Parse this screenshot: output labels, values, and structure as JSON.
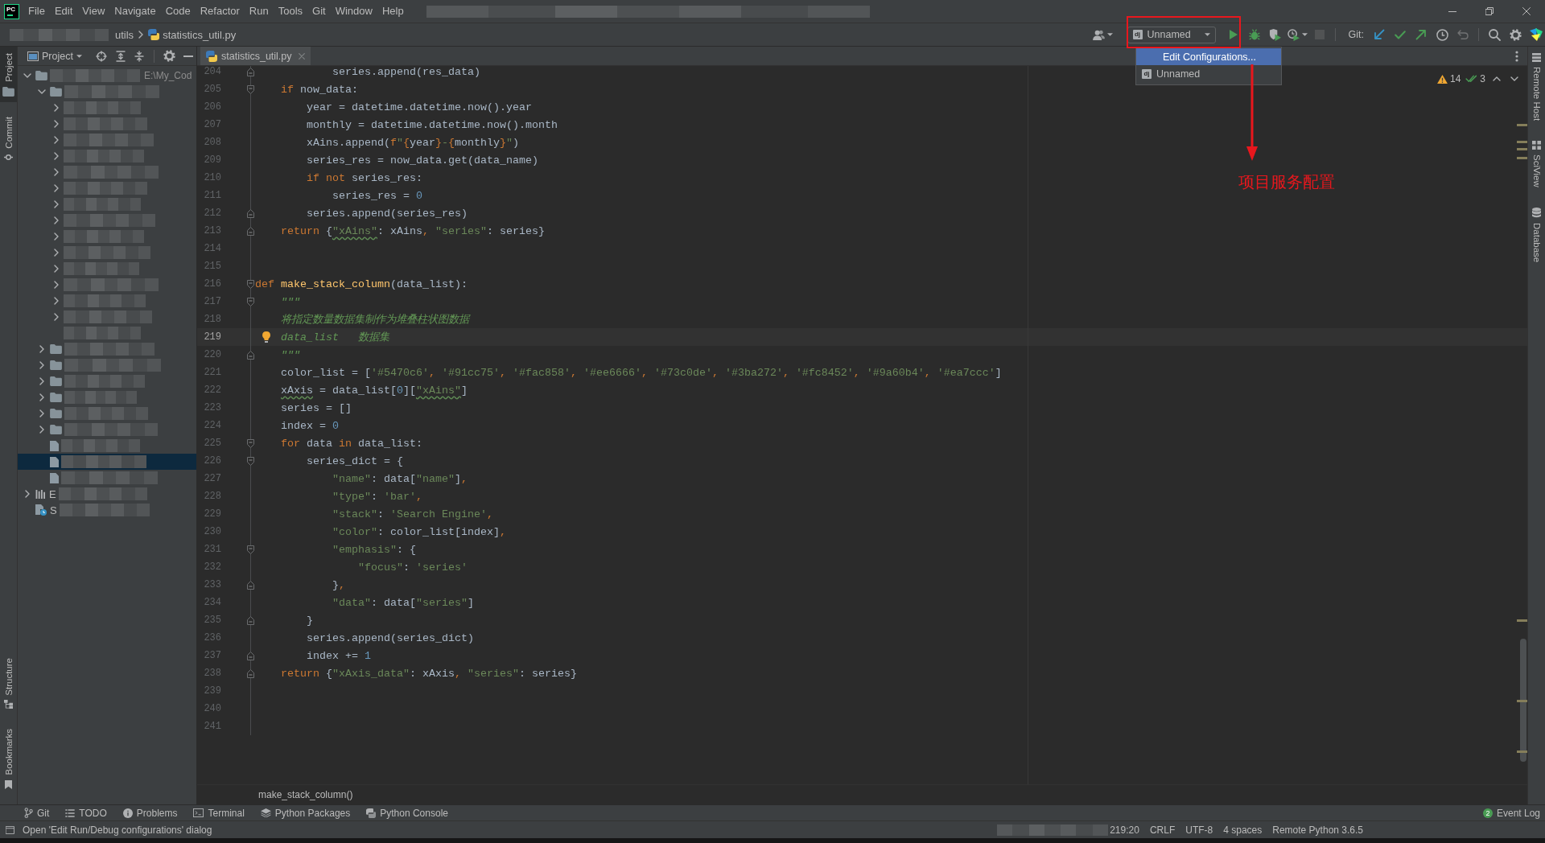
{
  "menu_bar": {
    "logo": "PC",
    "items": [
      "File",
      "Edit",
      "View",
      "Navigate",
      "Code",
      "Refactor",
      "Run",
      "Tools",
      "Git",
      "Window",
      "Help"
    ]
  },
  "navigation_bar": {
    "crumbs": [
      {
        "kind": "folder",
        "label": "utils"
      },
      {
        "kind": "python_file",
        "label": "statistics_util.py"
      }
    ]
  },
  "toolbar": {
    "left_buttons": [
      {
        "kind": "users",
        "disabled": false
      }
    ],
    "run_config": {
      "tag": "dj",
      "label": "Unnamed"
    },
    "run_buttons": [
      {
        "kind": "run",
        "disabled": false
      },
      {
        "kind": "debug",
        "disabled": false
      },
      {
        "kind": "coverage",
        "disabled": false
      },
      {
        "kind": "profile",
        "disabled": false
      },
      {
        "kind": "stop",
        "disabled": true
      }
    ],
    "git_label": "Git:",
    "git_buttons": [
      {
        "kind": "update",
        "disabled": false
      },
      {
        "kind": "commit",
        "disabled": false
      },
      {
        "kind": "push",
        "disabled": false
      },
      {
        "kind": "history",
        "disabled": false
      },
      {
        "kind": "rollback",
        "disabled": true
      }
    ],
    "tool_buttons": [
      {
        "kind": "search",
        "disabled": false
      },
      {
        "kind": "settings",
        "disabled": false
      },
      {
        "kind": "logo",
        "disabled": false
      }
    ]
  },
  "run_config_menu": {
    "items": [
      {
        "label": "Edit Configurations...",
        "selected": true
      },
      {
        "tag": "dj",
        "label": "Unnamed",
        "selected": false
      }
    ]
  },
  "annotation": {
    "label": "项目服务配置"
  },
  "left_tool_strip": {
    "top": [
      {
        "kind": "project",
        "label": "Project",
        "selected": true
      },
      {
        "kind": "commit",
        "label": "Commit",
        "selected": false
      }
    ],
    "bottom": [
      {
        "kind": "structure",
        "label": "Structure",
        "selected": false
      },
      {
        "kind": "bookmarks",
        "label": "Bookmarks",
        "selected": false
      }
    ]
  },
  "project_panel": {
    "title": "Project",
    "tree": [
      {
        "kind": "folder",
        "expanded": true,
        "selected": false,
        "path": "E:\\My_Cod",
        "children": [
          {
            "kind": "folder",
            "expanded": true,
            "selected": false,
            "children": [
              {
                "expanded": false,
                "selected": false
              },
              {
                "expanded": false,
                "selected": false
              },
              {
                "expanded": false,
                "selected": false
              },
              {
                "expanded": false,
                "selected": false
              },
              {
                "expanded": false,
                "selected": false
              },
              {
                "expanded": false,
                "selected": false
              },
              {
                "expanded": false,
                "selected": false
              },
              {
                "expanded": false,
                "selected": false
              },
              {
                "expanded": false,
                "selected": false
              },
              {
                "expanded": false,
                "selected": false
              },
              {
                "expanded": false,
                "selected": false
              },
              {
                "expanded": false,
                "selected": false
              },
              {
                "expanded": false,
                "selected": false
              },
              {
                "expanded": false,
                "selected": false
              },
              {
                "selected": false
              }
            ]
          },
          {
            "kind": "folder",
            "expanded": false,
            "selected": false
          },
          {
            "kind": "folder",
            "expanded": false,
            "selected": false
          },
          {
            "kind": "folder",
            "expanded": false,
            "selected": false
          },
          {
            "kind": "folder",
            "expanded": false,
            "selected": false
          },
          {
            "kind": "folder",
            "expanded": false,
            "selected": false
          },
          {
            "kind": "folder",
            "expanded": false,
            "selected": false
          },
          {
            "kind": "file",
            "selected": false
          },
          {
            "kind": "file",
            "selected": true
          },
          {
            "kind": "file",
            "selected": false
          }
        ]
      },
      {
        "kind": "libraries",
        "expanded": false,
        "selected": false,
        "label": "E"
      },
      {
        "kind": "scratches",
        "selected": false,
        "label": "S"
      }
    ]
  },
  "editor": {
    "tabs": [
      {
        "label": "statistics_util.py",
        "selected": true
      }
    ],
    "inspections": {
      "warnings": "14",
      "weak_warnings": "3"
    },
    "lines": [
      {
        "number": "204",
        "current": false,
        "fold": {
          "kind": "end"
        },
        "tokens": [
          {
            "kind": "plain",
            "text": "            series.append(res_data)"
          }
        ]
      },
      {
        "number": "205",
        "current": false,
        "fold": {
          "kind": "start"
        },
        "tokens": [
          {
            "kind": "kw",
            "text": "    if"
          },
          {
            "kind": "plain",
            "text": " now_data:"
          }
        ]
      },
      {
        "number": "206",
        "current": false,
        "tokens": [
          {
            "kind": "plain",
            "text": "        year = datetime.datetime.now().year"
          }
        ]
      },
      {
        "number": "207",
        "current": false,
        "tokens": [
          {
            "kind": "plain",
            "text": "        monthly = datetime.datetime.now().month"
          }
        ]
      },
      {
        "number": "208",
        "current": false,
        "tokens": [
          {
            "kind": "plain",
            "text": "        xAins.append("
          },
          {
            "kind": "kw",
            "text": "f"
          },
          {
            "kind": "str",
            "text": "\""
          },
          {
            "kind": "punct",
            "text": "{"
          },
          {
            "kind": "plain",
            "text": "year"
          },
          {
            "kind": "punct",
            "text": "}"
          },
          {
            "kind": "str",
            "text": "-"
          },
          {
            "kind": "punct",
            "text": "{"
          },
          {
            "kind": "plain",
            "text": "monthly"
          },
          {
            "kind": "punct",
            "text": "}"
          },
          {
            "kind": "str",
            "text": "\""
          },
          {
            "kind": "plain",
            "text": ")"
          }
        ]
      },
      {
        "number": "209",
        "current": false,
        "tokens": [
          {
            "kind": "plain",
            "text": "        series_res = now_data.get(data_name)"
          }
        ]
      },
      {
        "number": "210",
        "current": false,
        "tokens": [
          {
            "kind": "kw",
            "text": "        if not"
          },
          {
            "kind": "plain",
            "text": " series_res:"
          }
        ]
      },
      {
        "number": "211",
        "current": false,
        "tokens": [
          {
            "kind": "plain",
            "text": "            series_res = "
          },
          {
            "kind": "num",
            "text": "0"
          }
        ]
      },
      {
        "number": "212",
        "current": false,
        "fold": {
          "kind": "end"
        },
        "tokens": [
          {
            "kind": "plain",
            "text": "        series.append(series_res)"
          }
        ]
      },
      {
        "number": "213",
        "current": false,
        "fold": {
          "kind": "end"
        },
        "tokens": [
          {
            "kind": "kw",
            "text": "    return"
          },
          {
            "kind": "plain",
            "text": " {"
          },
          {
            "kind": "typo_str",
            "text": "\"xAins\""
          },
          {
            "kind": "plain",
            "text": ": xAins"
          },
          {
            "kind": "punct",
            "text": ", "
          },
          {
            "kind": "str",
            "text": "\"series\""
          },
          {
            "kind": "plain",
            "text": ": series}"
          }
        ]
      },
      {
        "number": "214",
        "current": false
      },
      {
        "number": "215",
        "current": false
      },
      {
        "number": "216",
        "current": false,
        "fold": {
          "kind": "start"
        },
        "tokens": [
          {
            "kind": "kw",
            "text": "def "
          },
          {
            "kind": "fn",
            "text": "make_stack_column"
          },
          {
            "kind": "plain",
            "text": "(data_list):"
          }
        ]
      },
      {
        "number": "217",
        "current": false,
        "fold": {
          "kind": "start"
        },
        "tokens": [
          {
            "kind": "doc",
            "text": "    \"\"\""
          }
        ]
      },
      {
        "number": "218",
        "current": false,
        "tokens": [
          {
            "kind": "doc",
            "text": "    将指定数量数据集制作为堆叠柱状图数据"
          }
        ]
      },
      {
        "number": "219",
        "current": true,
        "tokens": [
          {
            "kind": "doc",
            "text": "    data_list   数据集"
          }
        ]
      },
      {
        "number": "220",
        "current": false,
        "fold": {
          "kind": "end"
        },
        "tokens": [
          {
            "kind": "doc",
            "text": "    \"\"\""
          }
        ]
      },
      {
        "number": "221",
        "current": false,
        "tokens": [
          {
            "kind": "plain",
            "text": "    color_list = ["
          },
          {
            "kind": "str",
            "text": "'#5470c6'"
          },
          {
            "kind": "punct",
            "text": ", "
          },
          {
            "kind": "str",
            "text": "'#91cc75'"
          },
          {
            "kind": "punct",
            "text": ", "
          },
          {
            "kind": "str",
            "text": "'#fac858'"
          },
          {
            "kind": "punct",
            "text": ", "
          },
          {
            "kind": "str",
            "text": "'#ee6666'"
          },
          {
            "kind": "punct",
            "text": ", "
          },
          {
            "kind": "str",
            "text": "'#73c0de'"
          },
          {
            "kind": "punct",
            "text": ", "
          },
          {
            "kind": "str",
            "text": "'#3ba272'"
          },
          {
            "kind": "punct",
            "text": ", "
          },
          {
            "kind": "str",
            "text": "'#fc8452'"
          },
          {
            "kind": "punct",
            "text": ", "
          },
          {
            "kind": "str",
            "text": "'#9a60b4'"
          },
          {
            "kind": "punct",
            "text": ", "
          },
          {
            "kind": "str",
            "text": "'#ea7ccc'"
          },
          {
            "kind": "plain",
            "text": "]"
          }
        ]
      },
      {
        "number": "222",
        "current": false,
        "tokens": [
          {
            "kind": "typo",
            "text": "    xAxis"
          },
          {
            "kind": "plain",
            "text": " = data_list["
          },
          {
            "kind": "num",
            "text": "0"
          },
          {
            "kind": "plain",
            "text": "]["
          },
          {
            "kind": "typo_str",
            "text": "\"xAins\""
          },
          {
            "kind": "plain",
            "text": "]"
          }
        ]
      },
      {
        "number": "223",
        "current": false,
        "tokens": [
          {
            "kind": "plain",
            "text": "    series = []"
          }
        ]
      },
      {
        "number": "224",
        "current": false,
        "tokens": [
          {
            "kind": "plain",
            "text": "    index = "
          },
          {
            "kind": "num",
            "text": "0"
          }
        ]
      },
      {
        "number": "225",
        "current": false,
        "fold": {
          "kind": "start"
        },
        "tokens": [
          {
            "kind": "kw",
            "text": "    for"
          },
          {
            "kind": "plain",
            "text": " data "
          },
          {
            "kind": "kw",
            "text": "in"
          },
          {
            "kind": "plain",
            "text": " data_list:"
          }
        ]
      },
      {
        "number": "226",
        "current": false,
        "fold": {
          "kind": "start"
        },
        "tokens": [
          {
            "kind": "plain",
            "text": "        series_dict = {"
          }
        ]
      },
      {
        "number": "227",
        "current": false,
        "tokens": [
          {
            "kind": "str",
            "text": "            \"name\""
          },
          {
            "kind": "plain",
            "text": ": data["
          },
          {
            "kind": "str",
            "text": "\"name\""
          },
          {
            "kind": "plain",
            "text": "]"
          },
          {
            "kind": "punct",
            "text": ","
          }
        ]
      },
      {
        "number": "228",
        "current": false,
        "tokens": [
          {
            "kind": "str",
            "text": "            \"type\""
          },
          {
            "kind": "plain",
            "text": ": "
          },
          {
            "kind": "str",
            "text": "'bar'"
          },
          {
            "kind": "punct",
            "text": ","
          }
        ]
      },
      {
        "number": "229",
        "current": false,
        "tokens": [
          {
            "kind": "str",
            "text": "            \"stack\""
          },
          {
            "kind": "plain",
            "text": ": "
          },
          {
            "kind": "str",
            "text": "'Search Engine'"
          },
          {
            "kind": "punct",
            "text": ","
          }
        ]
      },
      {
        "number": "230",
        "current": false,
        "tokens": [
          {
            "kind": "str",
            "text": "            \"color\""
          },
          {
            "kind": "plain",
            "text": ": color_list[index]"
          },
          {
            "kind": "punct",
            "text": ","
          }
        ]
      },
      {
        "number": "231",
        "current": false,
        "fold": {
          "kind": "start"
        },
        "tokens": [
          {
            "kind": "str",
            "text": "            \"emphasis\""
          },
          {
            "kind": "plain",
            "text": ": {"
          }
        ]
      },
      {
        "number": "232",
        "current": false,
        "tokens": [
          {
            "kind": "str",
            "text": "                \"focus\""
          },
          {
            "kind": "plain",
            "text": ": "
          },
          {
            "kind": "str",
            "text": "'series'"
          }
        ]
      },
      {
        "number": "233",
        "current": false,
        "fold": {
          "kind": "end"
        },
        "tokens": [
          {
            "kind": "plain",
            "text": "            }"
          },
          {
            "kind": "punct",
            "text": ","
          }
        ]
      },
      {
        "number": "234",
        "current": false,
        "tokens": [
          {
            "kind": "str",
            "text": "            \"data\""
          },
          {
            "kind": "plain",
            "text": ": data["
          },
          {
            "kind": "str",
            "text": "\"series\""
          },
          {
            "kind": "plain",
            "text": "]"
          }
        ]
      },
      {
        "number": "235",
        "current": false,
        "fold": {
          "kind": "end"
        },
        "tokens": [
          {
            "kind": "plain",
            "text": "        }"
          }
        ]
      },
      {
        "number": "236",
        "current": false,
        "tokens": [
          {
            "kind": "plain",
            "text": "        series.append(series_dict)"
          }
        ]
      },
      {
        "number": "237",
        "current": false,
        "fold": {
          "kind": "end"
        },
        "tokens": [
          {
            "kind": "plain",
            "text": "        index += "
          },
          {
            "kind": "num",
            "text": "1"
          }
        ]
      },
      {
        "number": "238",
        "current": false,
        "fold": {
          "kind": "end"
        },
        "tokens": [
          {
            "kind": "kw",
            "text": "    return"
          },
          {
            "kind": "plain",
            "text": " {"
          },
          {
            "kind": "str",
            "text": "\"xAxis_data\""
          },
          {
            "kind": "plain",
            "text": ": xAxis"
          },
          {
            "kind": "punct",
            "text": ", "
          },
          {
            "kind": "str",
            "text": "\"series\""
          },
          {
            "kind": "plain",
            "text": ": series}"
          }
        ]
      },
      {
        "number": "239",
        "current": false
      },
      {
        "number": "240",
        "current": false
      },
      {
        "number": "241",
        "current": false
      }
    ],
    "breadcrumb": "make_stack_column()"
  },
  "right_tool_strip": [
    {
      "kind": "remote_host",
      "label": "Remote Host",
      "selected": false
    },
    {
      "kind": "sciview",
      "label": "SciView",
      "selected": false
    },
    {
      "kind": "database",
      "label": "Database",
      "selected": false
    }
  ],
  "tool_window_bar": {
    "items": [
      {
        "kind": "git",
        "label": "Git"
      },
      {
        "kind": "todo",
        "label": "TODO"
      },
      {
        "kind": "problems",
        "label": "Problems"
      },
      {
        "kind": "terminal",
        "label": "Terminal"
      },
      {
        "kind": "packages",
        "label": "Python Packages"
      },
      {
        "kind": "console",
        "label": "Python Console"
      }
    ],
    "event_log": {
      "label": "Event Log",
      "count": "2"
    }
  },
  "status_bar": {
    "message": "Open 'Edit Run/Debug configurations' dialog",
    "items": [
      "219:20",
      "CRLF",
      "UTF-8",
      "4 spaces",
      "Remote Python 3.6.5"
    ]
  }
}
